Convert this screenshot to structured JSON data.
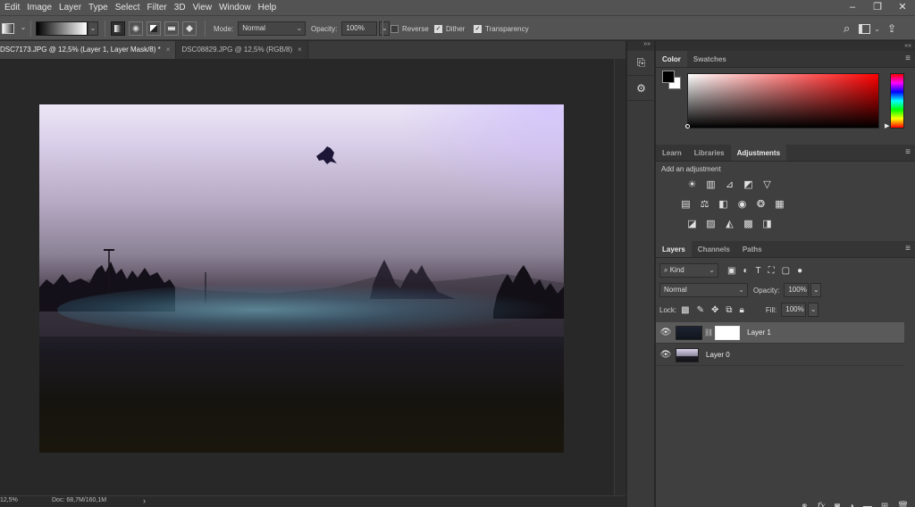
{
  "menu": [
    "Edit",
    "Image",
    "Layer",
    "Type",
    "Select",
    "Filter",
    "3D",
    "View",
    "Window",
    "Help"
  ],
  "window_controls": [
    "–",
    "❐",
    "✕"
  ],
  "options": {
    "mode_label": "Mode:",
    "mode_value": "Normal",
    "opacity_label": "Opacity:",
    "opacity_value": "100%",
    "reverse_label": "Reverse",
    "reverse_checked": false,
    "dither_label": "Dither",
    "dither_checked": true,
    "transparency_label": "Transparency",
    "transparency_checked": true
  },
  "doc_tabs": [
    {
      "label": "DSC7173.JPG @ 12,5% (Layer 1, Layer Mask/8) *",
      "active": true,
      "close": "×"
    },
    {
      "label": "DSC08829.JPG @ 12,5% (RGB/8)",
      "active": false,
      "close": "×"
    }
  ],
  "status": {
    "zoom": "12,5%",
    "doc": "Doc: 68,7M/160,1M",
    "arrow": "›"
  },
  "color_panel": {
    "tabs": [
      "Color",
      "Swatches"
    ],
    "foreground": "#000000",
    "background": "#ffffff",
    "hue_marker": "▶"
  },
  "adjust_panel": {
    "tabs": [
      "Learn",
      "Libraries",
      "Adjustments"
    ],
    "title": "Add an adjustment"
  },
  "layers_panel": {
    "tabs": [
      "Layers",
      "Channels",
      "Paths"
    ],
    "filter_value": "Kind",
    "blend_mode": "Normal",
    "opacity_label": "Opacity:",
    "opacity_value": "100%",
    "lock_label": "Lock:",
    "fill_label": "Fill:",
    "fill_value": "100%",
    "layers": [
      {
        "name": "Layer 1",
        "selected": true,
        "has_mask": true
      },
      {
        "name": "Layer 0",
        "selected": false,
        "has_mask": false
      }
    ]
  },
  "panel_menu": "≡",
  "collapse_arrows": "««",
  "expand_arrows": "»»"
}
